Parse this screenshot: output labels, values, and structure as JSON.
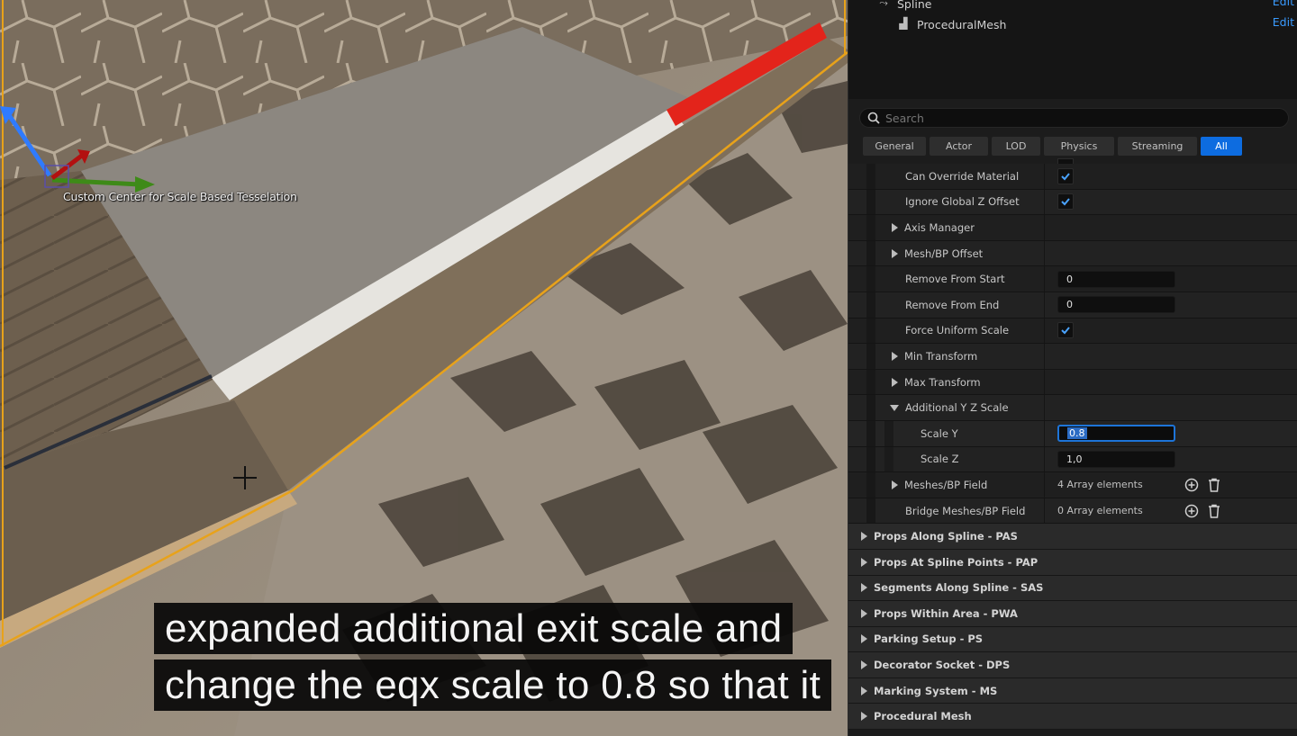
{
  "viewport": {
    "gizmo_label": "Custom Center for Scale Based Tesselation"
  },
  "components": {
    "items": [
      {
        "label": "Spline",
        "edit_label": "Edit",
        "icon": "spline-icon"
      },
      {
        "label": "ProceduralMesh",
        "edit_label": "Edit",
        "icon": "procedural-mesh-icon"
      }
    ]
  },
  "search": {
    "placeholder": "Search"
  },
  "filter_tabs": [
    {
      "label": "General",
      "active": false
    },
    {
      "label": "Actor",
      "active": false
    },
    {
      "label": "LOD",
      "active": false
    },
    {
      "label": "Physics",
      "active": false
    },
    {
      "label": "Streaming",
      "active": false
    },
    {
      "label": "All",
      "active": true
    }
  ],
  "properties": [
    {
      "label": "Can Override Material",
      "type": "checkbox",
      "checked": true
    },
    {
      "label": "Ignore Global Z Offset",
      "type": "checkbox",
      "checked": true
    },
    {
      "label": "Axis Manager",
      "type": "group",
      "expanded": false
    },
    {
      "label": "Mesh/BP Offset",
      "type": "group",
      "expanded": false
    },
    {
      "label": "Remove From Start",
      "type": "number",
      "value": "0"
    },
    {
      "label": "Remove From End",
      "type": "number",
      "value": "0"
    },
    {
      "label": "Force Uniform Scale",
      "type": "checkbox",
      "checked": true
    },
    {
      "label": "Min Transform",
      "type": "group",
      "expanded": false
    },
    {
      "label": "Max Transform",
      "type": "group",
      "expanded": false
    },
    {
      "label": "Additional Y Z Scale",
      "type": "group",
      "expanded": true
    },
    {
      "label": "Scale Y",
      "type": "number",
      "value": "0.8",
      "focused": true
    },
    {
      "label": "Scale Z",
      "type": "number",
      "value": "1,0"
    },
    {
      "label": "Meshes/BP Field",
      "type": "array",
      "value": "4 Array elements",
      "expandable": true
    },
    {
      "label": "Bridge Meshes/BP Field",
      "type": "array",
      "value": "0 Array elements",
      "expandable": false
    }
  ],
  "sections": [
    {
      "label": "Props Along Spline - PAS"
    },
    {
      "label": "Props At Spline Points - PAP"
    },
    {
      "label": "Segments Along Spline - SAS"
    },
    {
      "label": "Props Within Area - PWA"
    },
    {
      "label": "Parking Setup - PS"
    },
    {
      "label": "Decorator Socket - DPS"
    },
    {
      "label": "Marking System - MS"
    },
    {
      "label": "Procedural Mesh"
    }
  ],
  "caption": {
    "line1": "expanded additional exit scale and",
    "line2": "change the eqx scale to 0.8 so that it"
  },
  "colors": {
    "accent": "#0d6ce0",
    "link": "#3a9bff",
    "selection_outline": "#e8a21a",
    "stripe_red": "#e3241b"
  }
}
